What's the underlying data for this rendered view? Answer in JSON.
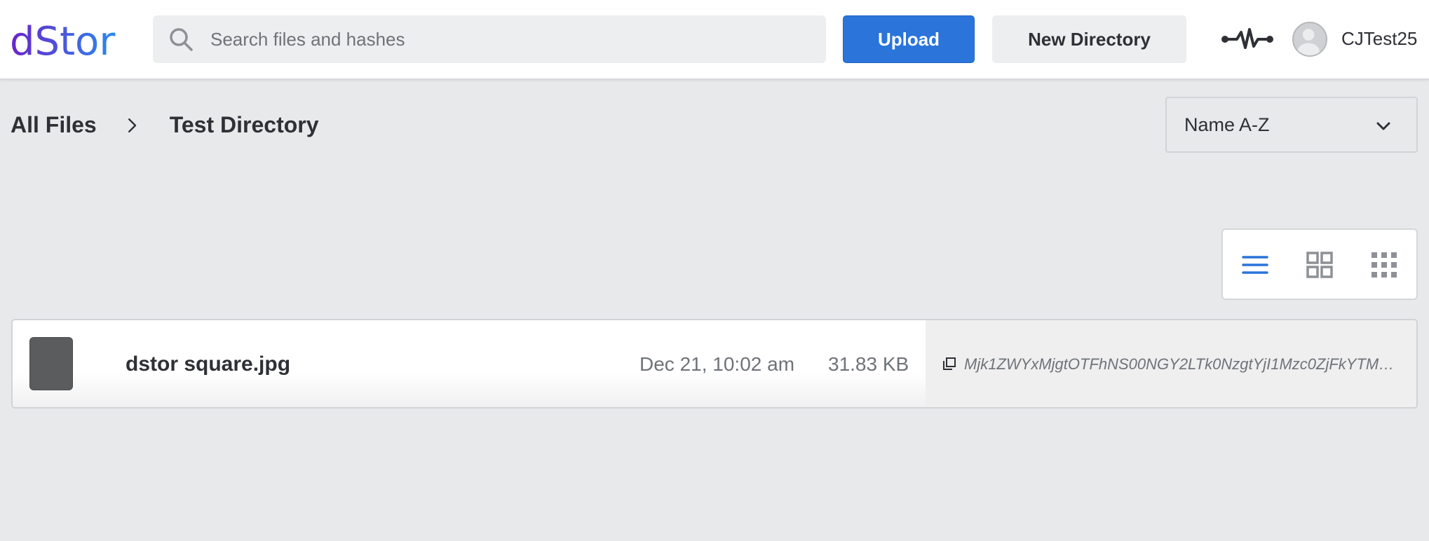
{
  "brand": {
    "name": "dStor",
    "gradient_start": "#6a24c8",
    "gradient_end": "#2a8af0"
  },
  "header": {
    "search_placeholder": "Search files and hashes",
    "upload_label": "Upload",
    "new_directory_label": "New Directory",
    "username": "CJTest25",
    "accent_color": "#2a74da"
  },
  "breadcrumb": {
    "items": [
      "All Files",
      "Test Directory"
    ]
  },
  "sort": {
    "selected": "Name A-Z"
  },
  "view_modes": {
    "active": "list",
    "options": [
      "list",
      "grid",
      "small-grid"
    ]
  },
  "files": [
    {
      "name": "dstor square.jpg",
      "date": "Dec 21, 10:02 am",
      "size": "31.83 KB",
      "hash": "Mjk1ZWYxMjgtOTFhNS00NGY2LTk0NzgtYjI1Mzc0ZjFkYTM1…"
    }
  ],
  "icons": {
    "search": "search-icon",
    "activity": "activity-icon",
    "avatar": "user-avatar-icon",
    "separator": "chevron-right-icon",
    "sort": "chevron-down-icon",
    "copy": "copy-icon"
  }
}
